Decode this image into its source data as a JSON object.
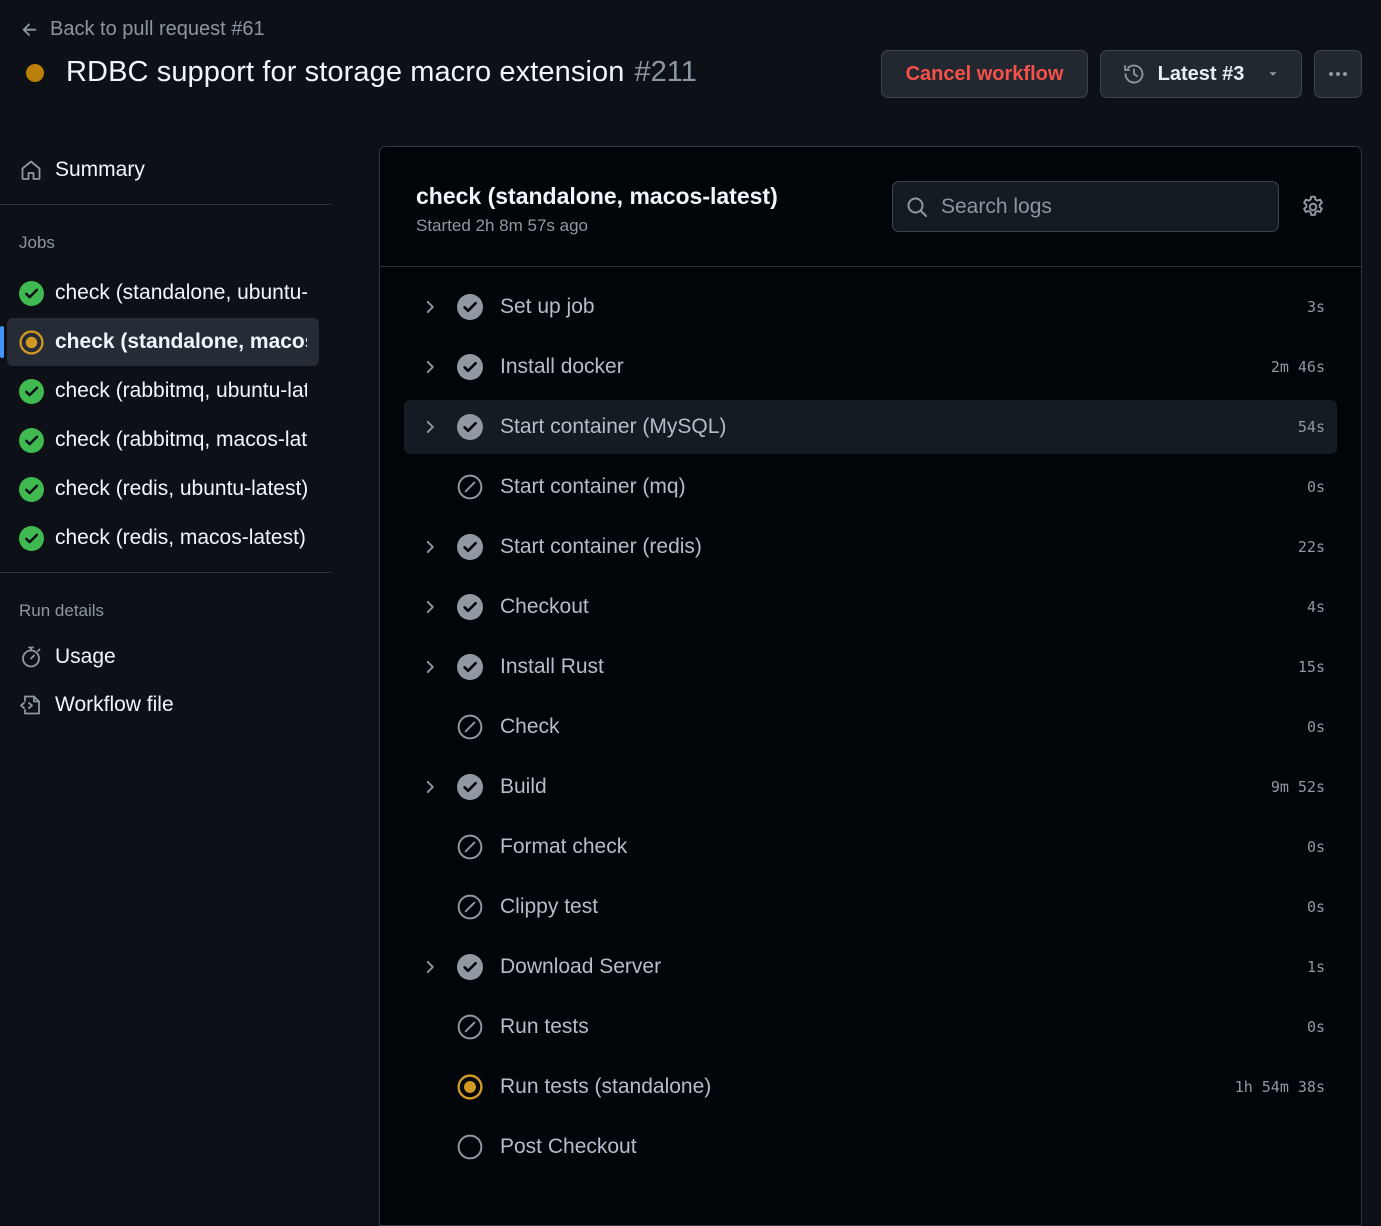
{
  "header": {
    "back_label": "Back to pull request #61",
    "run_title": "RDBC support for storage macro extension",
    "run_number": "#211",
    "cancel_label": "Cancel workflow",
    "latest_label": "Latest #3",
    "status_color": "#bb8009"
  },
  "sidebar": {
    "summary_label": "Summary",
    "jobs_heading": "Jobs",
    "jobs": [
      {
        "label": "check (standalone, ubuntu-latest)",
        "status": "success"
      },
      {
        "label": "check (standalone, macos-latest)",
        "status": "in_progress"
      },
      {
        "label": "check (rabbitmq, ubuntu-latest)",
        "status": "success"
      },
      {
        "label": "check (rabbitmq, macos-latest)",
        "status": "success"
      },
      {
        "label": "check (redis, ubuntu-latest)",
        "status": "success"
      },
      {
        "label": "check (redis, macos-latest)",
        "status": "success"
      }
    ],
    "run_details_heading": "Run details",
    "usage_label": "Usage",
    "workflow_file_label": "Workflow file"
  },
  "job": {
    "title": "check (standalone, macos-latest)",
    "started": "Started 2h 8m 57s ago",
    "search_placeholder": "Search logs"
  },
  "steps": [
    {
      "name": "Set up job",
      "duration": "3s",
      "status": "success",
      "expandable": true
    },
    {
      "name": "Install docker",
      "duration": "2m 46s",
      "status": "success",
      "expandable": true
    },
    {
      "name": "Start container (MySQL)",
      "duration": "54s",
      "status": "success",
      "expandable": true
    },
    {
      "name": "Start container (mq)",
      "duration": "0s",
      "status": "skipped",
      "expandable": false
    },
    {
      "name": "Start container (redis)",
      "duration": "22s",
      "status": "success",
      "expandable": true
    },
    {
      "name": "Checkout",
      "duration": "4s",
      "status": "success",
      "expandable": true
    },
    {
      "name": "Install Rust",
      "duration": "15s",
      "status": "success",
      "expandable": true
    },
    {
      "name": "Check",
      "duration": "0s",
      "status": "skipped",
      "expandable": false
    },
    {
      "name": "Build",
      "duration": "9m 52s",
      "status": "success",
      "expandable": true
    },
    {
      "name": "Format check",
      "duration": "0s",
      "status": "skipped",
      "expandable": false
    },
    {
      "name": "Clippy test",
      "duration": "0s",
      "status": "skipped",
      "expandable": false
    },
    {
      "name": "Download Server",
      "duration": "1s",
      "status": "success",
      "expandable": true
    },
    {
      "name": "Run tests",
      "duration": "0s",
      "status": "skipped",
      "expandable": false
    },
    {
      "name": "Run tests (standalone)",
      "duration": "1h 54m 38s",
      "status": "in_progress",
      "expandable": false
    },
    {
      "name": "Post Checkout",
      "duration": "",
      "status": "pending",
      "expandable": false
    }
  ],
  "colors": {
    "success": "#3fb950",
    "in_progress": "#d29922",
    "danger": "#f85149",
    "accent": "#4493f8"
  }
}
